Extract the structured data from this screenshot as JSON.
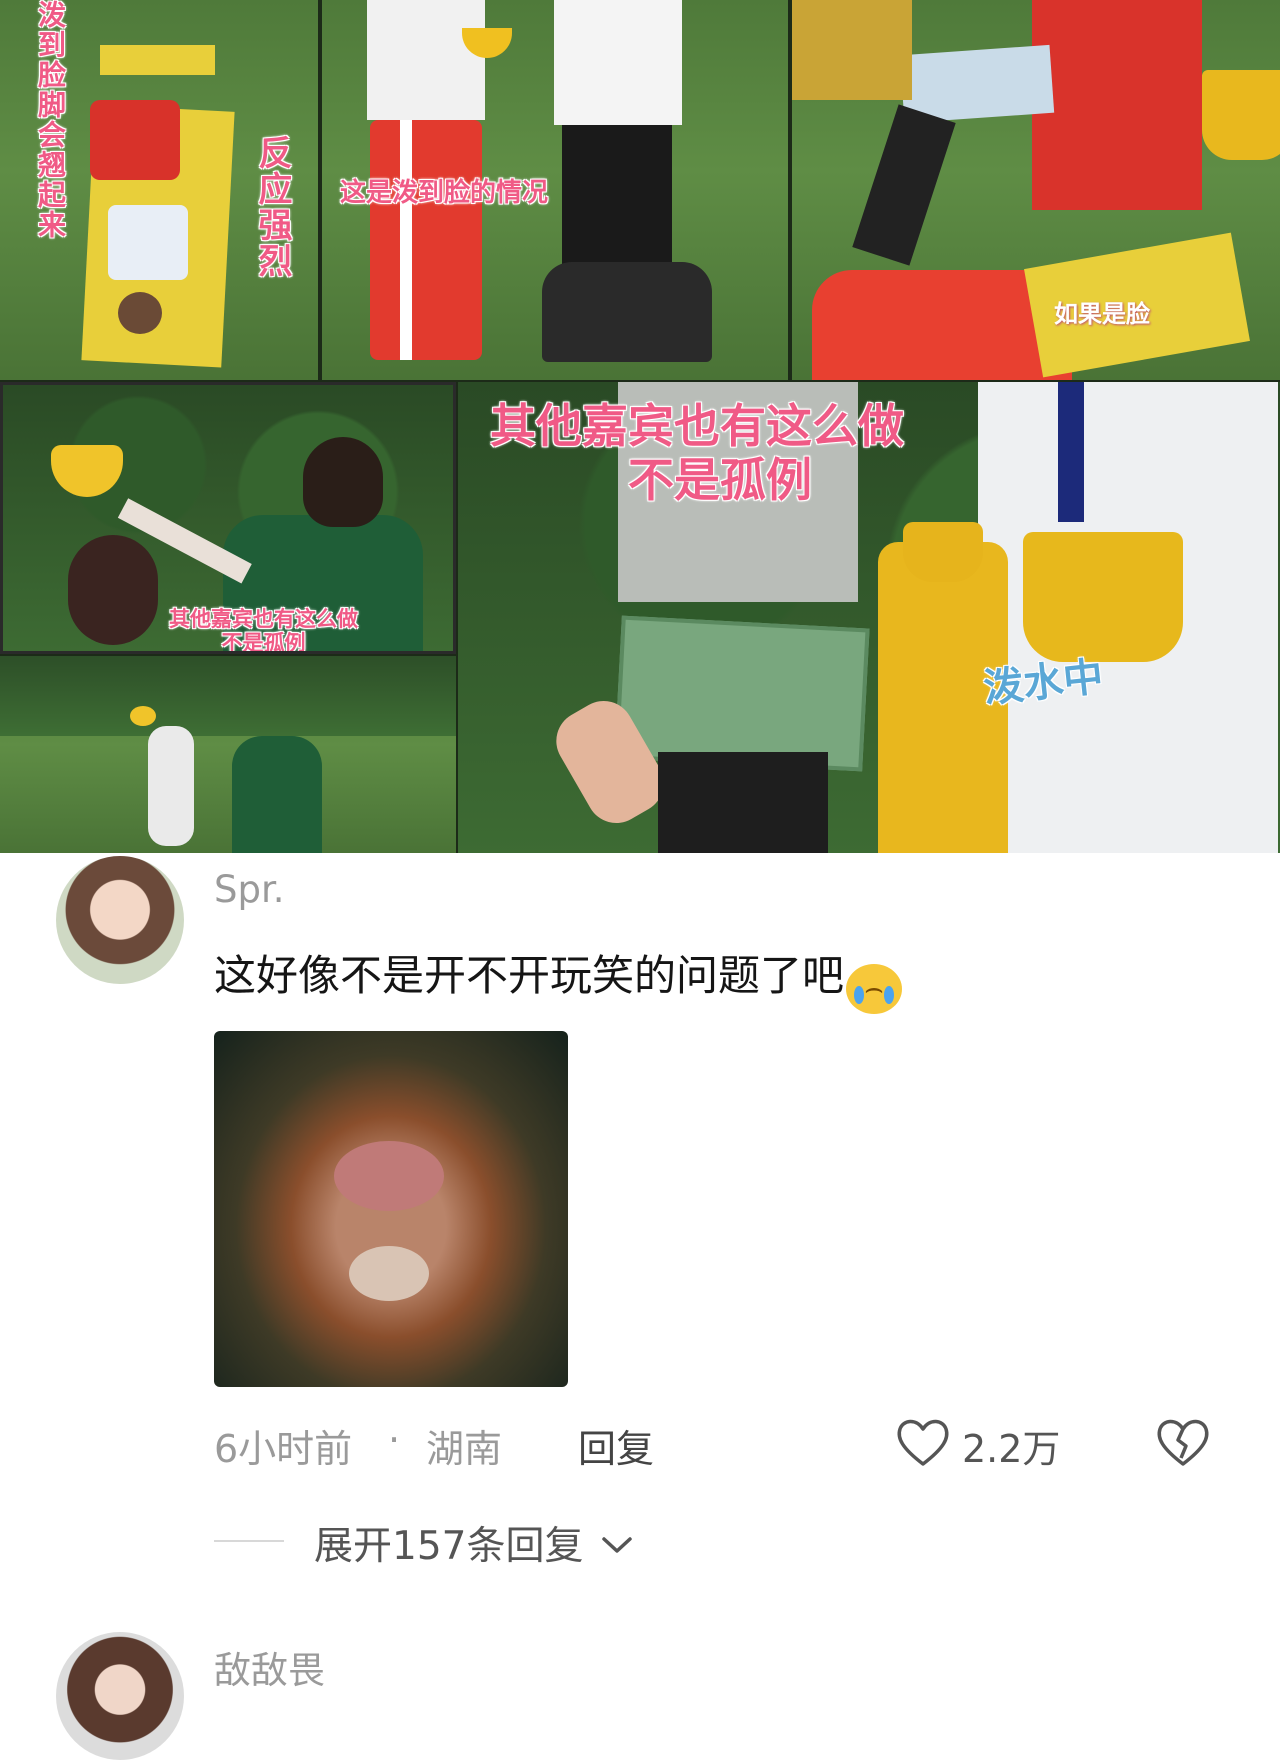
{
  "collage": {
    "captions": {
      "left_vertical_1": "泼到脸脚会翘起来",
      "left_vertical_2": "反应强烈",
      "middle_top": "这是泼到脸的情况",
      "right_top": "如果是脸",
      "bottom_left": "其他嘉宾也有这么做\n不是孤例",
      "bottom_right_line1": "其他嘉宾也有这么做",
      "bottom_right_line2": "不是孤例",
      "splashing": "泼水中"
    }
  },
  "comments": [
    {
      "username": "Spr.",
      "text": "这好像不是开不开玩笑的问题了吧",
      "emoji": "loudly-crying-face",
      "time": "6小时前",
      "separator": "·",
      "location": "湖南",
      "reply_label": "回复",
      "likes": "2.2万",
      "expand_label": "展开157条回复"
    },
    {
      "username": "敌敌畏"
    }
  ],
  "colors": {
    "caption_pink": "#f05a86",
    "caption_blue": "#5aa7d6",
    "meta_gray": "#9a9a9a"
  }
}
